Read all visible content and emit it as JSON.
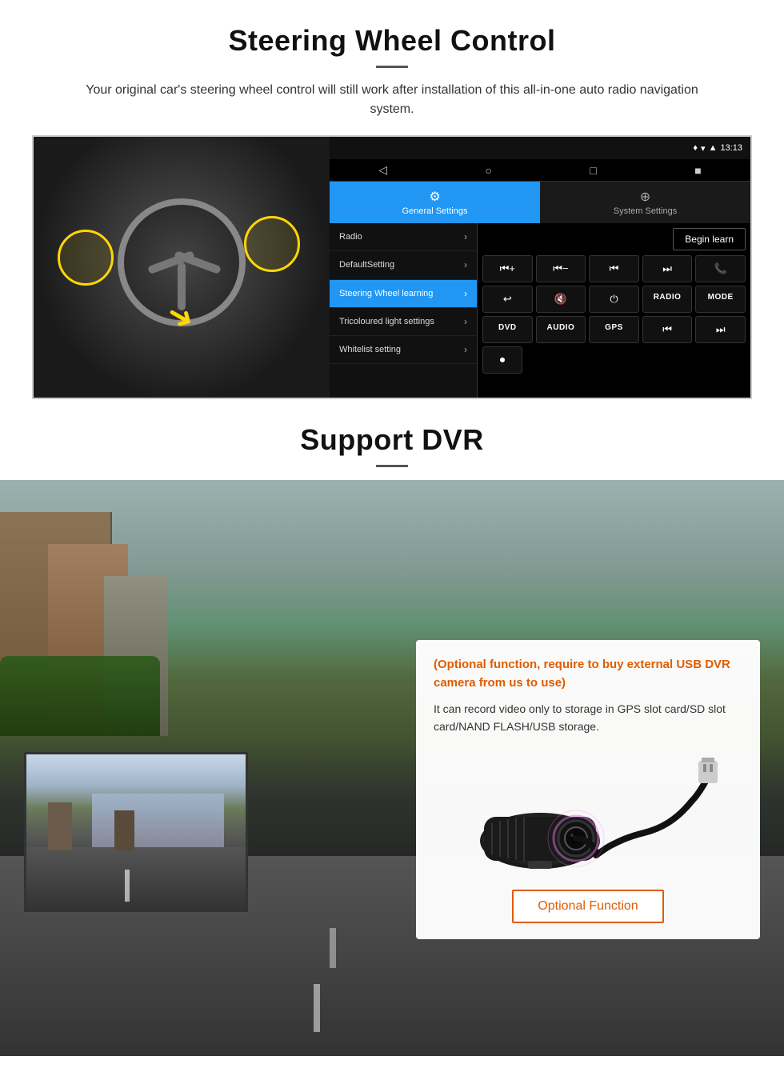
{
  "page": {
    "steering": {
      "title": "Steering Wheel Control",
      "subtitle": "Your original car's steering wheel control will still work after installation of this all-in-one auto radio navigation system.",
      "android": {
        "statusbar": {
          "time": "13:13",
          "signal_icon": "▼",
          "wifi_icon": "▾",
          "battery_icon": "▪"
        },
        "nav_icons": [
          "◁",
          "○",
          "□",
          "■"
        ],
        "tabs": {
          "general": {
            "icon": "⚙",
            "label": "General Settings"
          },
          "system": {
            "icon": "⊕",
            "label": "System Settings"
          }
        },
        "menu_items": [
          {
            "label": "Radio",
            "active": false
          },
          {
            "label": "DefaultSetting",
            "active": false
          },
          {
            "label": "Steering Wheel learning",
            "active": true
          },
          {
            "label": "Tricoloured light settings",
            "active": false
          },
          {
            "label": "Whitelist setting",
            "active": false
          }
        ],
        "begin_learn": "Begin learn",
        "control_buttons": {
          "row1": [
            "⏮+",
            "⏮−",
            "⏮",
            "⏭",
            "☎"
          ],
          "row2": [
            "↩",
            "🔇×",
            "⏻",
            "RADIO",
            "MODE"
          ],
          "row3": [
            "DVD",
            "AUDIO",
            "GPS",
            "⏮",
            "⏭"
          ],
          "row4": [
            "⏺"
          ]
        }
      }
    },
    "dvr": {
      "title": "Support DVR",
      "card": {
        "optional_text": "(Optional function, require to buy external USB DVR camera from us to use)",
        "desc_text": "It can record video only to storage in GPS slot card/SD slot card/NAND FLASH/USB storage.",
        "optional_button_label": "Optional Function"
      }
    }
  }
}
